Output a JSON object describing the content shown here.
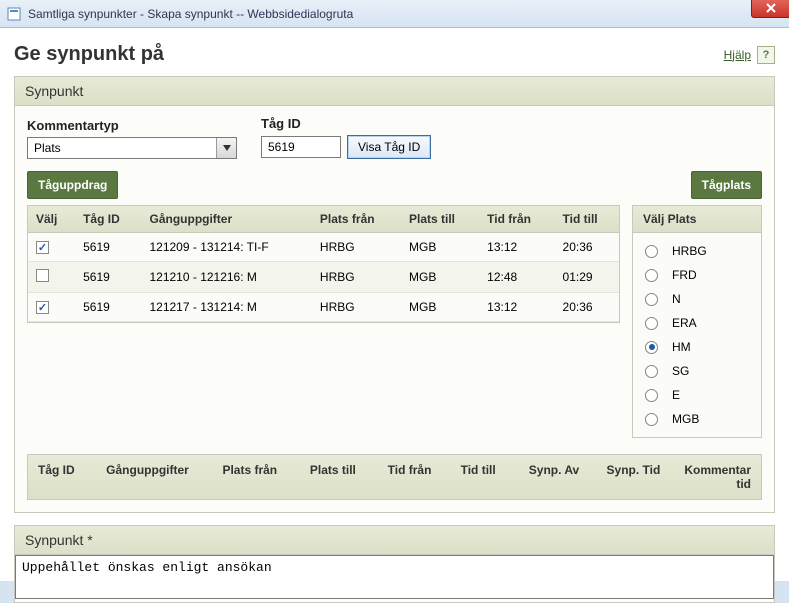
{
  "window": {
    "title": "Samtliga synpunkter - Skapa synpunkt -- Webbsidedialogruta"
  },
  "page": {
    "title": "Ge synpunkt på",
    "help_label": "Hjälp"
  },
  "synpunkt_panel": {
    "title": "Synpunkt",
    "kommentartyp_label": "Kommentartyp",
    "kommentartyp_value": "Plats",
    "tagid_label": "Tåg ID",
    "tagid_value": "5619",
    "visa_btn": "Visa Tåg ID",
    "taguppdrag_btn": "Tåguppdrag",
    "tagplats_btn": "Tågplats"
  },
  "table": {
    "headers": {
      "valj": "Välj",
      "tagid": "Tåg ID",
      "gang": "Gånguppgifter",
      "platsfran": "Plats från",
      "platstill": "Plats till",
      "tidfran": "Tid från",
      "tidtill": "Tid till"
    },
    "rows": [
      {
        "checked": true,
        "tagid": "5619",
        "gang": "121209 - 131214: TI-F",
        "platsfran": "HRBG",
        "platstill": "MGB",
        "tidfran": "13:12",
        "tidtill": "20:36"
      },
      {
        "checked": false,
        "tagid": "5619",
        "gang": "121210 - 121216: M",
        "platsfran": "HRBG",
        "platstill": "MGB",
        "tidfran": "12:48",
        "tidtill": "01:29"
      },
      {
        "checked": true,
        "tagid": "5619",
        "gang": "121217 - 131214: M",
        "platsfran": "HRBG",
        "platstill": "MGB",
        "tidfran": "13:12",
        "tidtill": "20:36"
      }
    ]
  },
  "side": {
    "title": "Välj Plats",
    "options": [
      {
        "label": "HRBG",
        "checked": false
      },
      {
        "label": "FRD",
        "checked": false
      },
      {
        "label": "N",
        "checked": false
      },
      {
        "label": "ERA",
        "checked": false
      },
      {
        "label": "HM",
        "checked": true
      },
      {
        "label": "SG",
        "checked": false
      },
      {
        "label": "E",
        "checked": false
      },
      {
        "label": "MGB",
        "checked": false
      }
    ]
  },
  "lower_headers": {
    "tagid": "Tåg ID",
    "gang": "Gånguppgifter",
    "platsfran": "Plats från",
    "platstill": "Plats till",
    "tidfran": "Tid från",
    "tidtill": "Tid till",
    "synpav": "Synp. Av",
    "synptid": "Synp. Tid",
    "kommentartid": "Kommentar tid"
  },
  "synpunkt2": {
    "title": "Synpunkt *",
    "value": "Uppehållet önskas enligt ansökan"
  }
}
